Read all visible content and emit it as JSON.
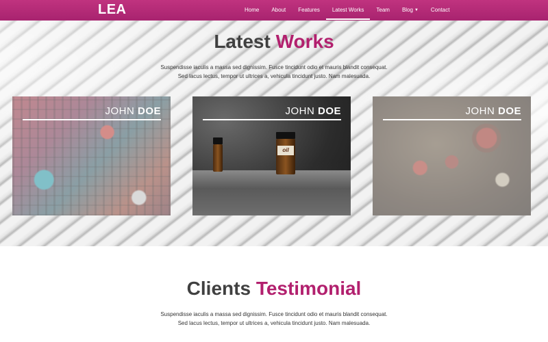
{
  "navbar": {
    "brand": "LEA",
    "items": [
      {
        "label": "Home",
        "active": false
      },
      {
        "label": "About",
        "active": false
      },
      {
        "label": "Features",
        "active": false
      },
      {
        "label": "Latest Works",
        "active": true
      },
      {
        "label": "Team",
        "active": false
      },
      {
        "label": "Blog",
        "active": false,
        "dropdown": true
      },
      {
        "label": "Contact",
        "active": false
      }
    ],
    "color": "#b2206e"
  },
  "works": {
    "title_plain": "Latest",
    "title_accent": "Works",
    "desc_line1": "Suspendisse iaculis a massa sed dignissim. Fusce tincidunt odio et mauris blandit consequat.",
    "desc_line2": "Sed lacus lectus, tempor ut ultrices a, vehicula tincidunt justo. Nam malesuada.",
    "cards": [
      {
        "first": "JOHN",
        "last": "DOE",
        "image": "neon-signs"
      },
      {
        "first": "JOHN",
        "last": "DOE",
        "image": "oil-bottles",
        "bottle_label": "oil"
      },
      {
        "first": "JOHN",
        "last": "DOE",
        "image": "carousel-aerial"
      }
    ]
  },
  "testimonial": {
    "title_plain": "Clients",
    "title_accent": "Testimonial",
    "desc_line1": "Suspendisse iaculis a massa sed dignissim. Fusce tincidunt odio et mauris blandit consequat.",
    "desc_line2": "Sed lacus lectus, tempor ut ultrices a, vehicula tincidunt justo. Nam malesuada."
  },
  "colors": {
    "accent": "#b2206e",
    "heading": "#404040"
  }
}
